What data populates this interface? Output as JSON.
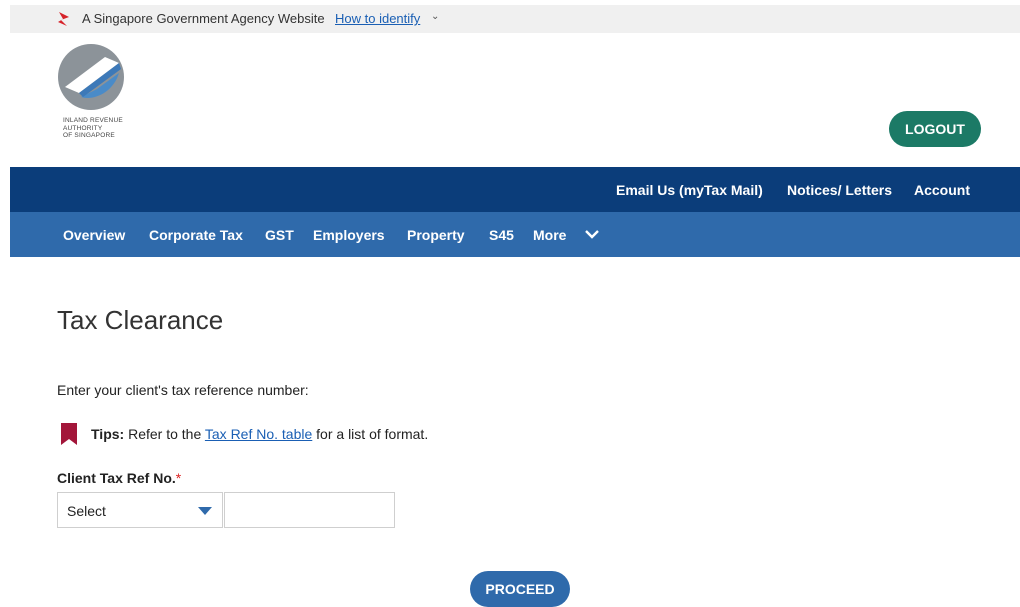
{
  "gov_banner": {
    "text": "A Singapore Government Agency Website",
    "link": "How to identify",
    "chevron": "⌄"
  },
  "brand": {
    "agency_line1": "INLAND REVENUE",
    "agency_line2": "AUTHORITY",
    "agency_line3": "OF SINGAPORE",
    "logout_label": "LOGOUT"
  },
  "top_nav": {
    "items": [
      "Email Us (myTax Mail)",
      "Notices/ Letters",
      "Account"
    ]
  },
  "main_nav": {
    "items": [
      "Overview",
      "Corporate Tax",
      "GST",
      "Employers",
      "Property",
      "S45",
      "More"
    ]
  },
  "page": {
    "title": "Tax Clearance",
    "instruction": "Enter your client's tax reference number:",
    "tips_label": "Tips:",
    "tips_pre": " Refer to the ",
    "tips_link": "Tax Ref No. table",
    "tips_post": " for a list of format."
  },
  "form": {
    "field_label": "Client Tax Ref No.",
    "required_mark": "*",
    "select_value": "Select",
    "input_value": "",
    "proceed_label": "PROCEED"
  },
  "colors": {
    "top_nav": "#0b3d7a",
    "main_nav": "#2f6aab",
    "logout": "#1c7a66",
    "link": "#1a5fb4",
    "bookmark": "#a3163a"
  }
}
